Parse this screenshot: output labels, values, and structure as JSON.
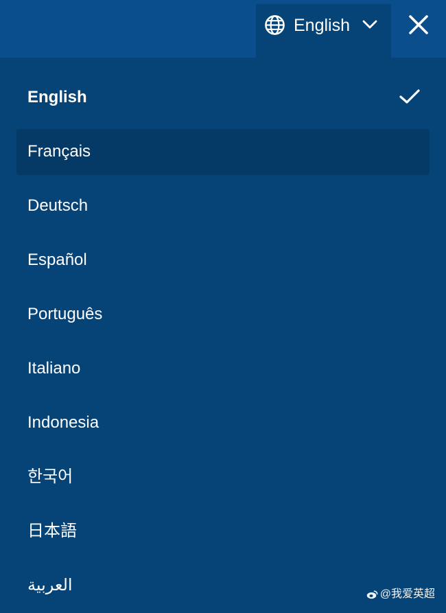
{
  "header": {
    "current_language": "English",
    "icons": {
      "globe": "globe-icon",
      "dropdown": "chevron-down-icon",
      "close": "close-icon"
    }
  },
  "languages": [
    {
      "label": "English",
      "selected": true,
      "highlighted": false
    },
    {
      "label": "Français",
      "selected": false,
      "highlighted": true
    },
    {
      "label": "Deutsch",
      "selected": false,
      "highlighted": false
    },
    {
      "label": "Español",
      "selected": false,
      "highlighted": false
    },
    {
      "label": "Português",
      "selected": false,
      "highlighted": false
    },
    {
      "label": "Italiano",
      "selected": false,
      "highlighted": false
    },
    {
      "label": "Indonesia",
      "selected": false,
      "highlighted": false
    },
    {
      "label": "한국어",
      "selected": false,
      "highlighted": false
    },
    {
      "label": "日本語",
      "selected": false,
      "highlighted": false
    },
    {
      "label": "العربية",
      "selected": false,
      "highlighted": false
    }
  ],
  "watermark": {
    "text": "@我爱英超"
  },
  "colors": {
    "background": "#064477",
    "topbar": "#0a4f8b",
    "highlight": "#053a66",
    "text": "#ffffff"
  }
}
